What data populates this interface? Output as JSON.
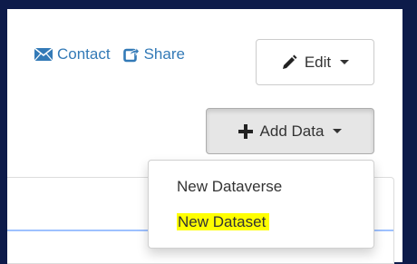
{
  "header_links": {
    "contact_label": "Contact",
    "share_label": "Share"
  },
  "buttons": {
    "edit_label": "Edit",
    "add_data_label": "Add Data"
  },
  "add_data_menu": {
    "items": [
      {
        "label": "New Dataverse"
      },
      {
        "label": "New Dataset",
        "highlighted": true
      }
    ]
  },
  "icons": {
    "contact": "envelope-icon",
    "share": "share-icon",
    "edit": "pencil-icon",
    "add": "plus-icon"
  },
  "colors": {
    "background": "#0d1b4a",
    "link": "#337ab7",
    "highlight": "#ffff00"
  }
}
